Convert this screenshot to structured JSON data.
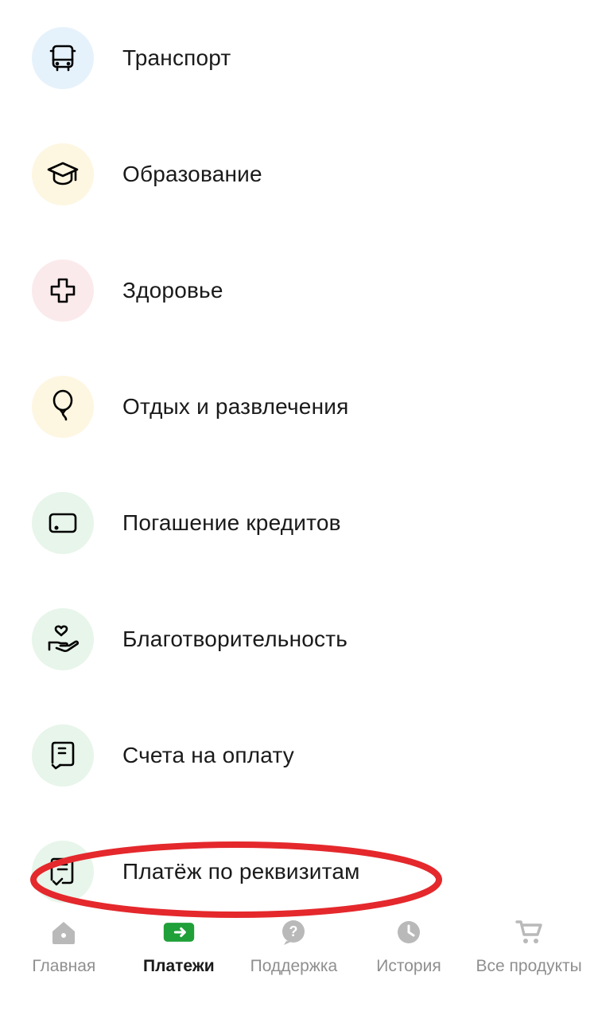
{
  "categories": [
    {
      "label": "Транспорт",
      "icon": "bus",
      "bg": "blue"
    },
    {
      "label": "Образование",
      "icon": "graduation",
      "bg": "yellow"
    },
    {
      "label": "Здоровье",
      "icon": "health",
      "bg": "pink"
    },
    {
      "label": "Отдых и развлечения",
      "icon": "balloon",
      "bg": "yellow"
    },
    {
      "label": "Погашение кредитов",
      "icon": "card",
      "bg": "green"
    },
    {
      "label": "Благотворительность",
      "icon": "charity",
      "bg": "green"
    },
    {
      "label": "Счета на оплату",
      "icon": "invoice",
      "bg": "green"
    },
    {
      "label": "Платёж по реквизитам",
      "icon": "details",
      "bg": "green"
    }
  ],
  "tabs": [
    {
      "label": "Главная",
      "icon": "home",
      "active": false
    },
    {
      "label": "Платежи",
      "icon": "payments",
      "active": true
    },
    {
      "label": "Поддержка",
      "icon": "support",
      "active": false
    },
    {
      "label": "История",
      "icon": "history",
      "active": false
    },
    {
      "label": "Все продукты",
      "icon": "cart",
      "active": false
    }
  ],
  "highlighted_index": 7
}
